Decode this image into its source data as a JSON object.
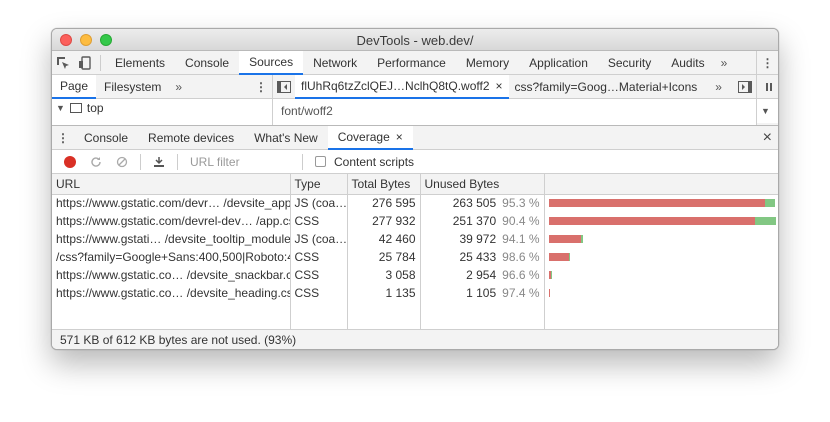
{
  "window": {
    "title": "DevTools - web.dev/"
  },
  "main_tabs": [
    "Elements",
    "Console",
    "Sources",
    "Network",
    "Performance",
    "Memory",
    "Application",
    "Security",
    "Audits"
  ],
  "active_main_tab": "Sources",
  "overflow_glyph": "»",
  "navigator": {
    "tabs": [
      "Page",
      "Filesystem"
    ],
    "tree_top": "top"
  },
  "editor": {
    "tabs": [
      {
        "label": "flUhRq6tzZclQEJ…NclhQ8tQ.woff2",
        "close": "×"
      },
      {
        "label": "css?family=Goog…Material+Icons"
      }
    ],
    "content_line": "font/woff2"
  },
  "drawer": {
    "tabs": [
      "Console",
      "Remote devices",
      "What's New",
      "Coverage"
    ],
    "active": "Coverage",
    "close_glyph": "×"
  },
  "coverage": {
    "url_filter_placeholder": "URL filter",
    "content_scripts_label": "Content scripts",
    "columns": [
      "URL",
      "Type",
      "Total Bytes",
      "Unused Bytes"
    ],
    "rows": [
      {
        "url": "https://www.gstatic.com/devr… /devsite_app.js",
        "type": "JS (coa…",
        "total": "276 595",
        "unused": "263 505",
        "pct": "95.3 %"
      },
      {
        "url": "https://www.gstatic.com/devrel-dev… /app.css",
        "type": "CSS",
        "total": "277 932",
        "unused": "251 370",
        "pct": "90.4 %"
      },
      {
        "url": "https://www.gstati… /devsite_tooltip_module.js",
        "type": "JS (coa…",
        "total": "42 460",
        "unused": "39 972",
        "pct": "94.1 %"
      },
      {
        "url": "/css?family=Google+Sans:400,500|Roboto:400…",
        "type": "CSS",
        "total": "25 784",
        "unused": "25 433",
        "pct": "98.6 %"
      },
      {
        "url": "https://www.gstatic.co… /devsite_snackbar.css",
        "type": "CSS",
        "total": "3 058",
        "unused": "2 954",
        "pct": "96.6 %"
      },
      {
        "url": "https://www.gstatic.co… /devsite_heading.css",
        "type": "CSS",
        "total": "1 135",
        "unused": "1 105",
        "pct": "97.4 %"
      }
    ],
    "bars": [
      {
        "unused_fraction_of_max": 0.948,
        "used_fraction_of_max": 0.047
      },
      {
        "unused_fraction_of_max": 0.905,
        "used_fraction_of_max": 0.095
      },
      {
        "unused_fraction_of_max": 0.144,
        "used_fraction_of_max": 0.009
      },
      {
        "unused_fraction_of_max": 0.092,
        "used_fraction_of_max": 0.001
      },
      {
        "unused_fraction_of_max": 0.011,
        "used_fraction_of_max": 0.0004
      },
      {
        "unused_fraction_of_max": 0.004,
        "used_fraction_of_max": 0.0001
      }
    ],
    "status": "571 KB of 612 KB bytes are not used. (93%)",
    "colors": {
      "unused": "#d9706c",
      "used": "#82c783",
      "record": "#d93025",
      "active_tab": "#1a73e8"
    }
  }
}
